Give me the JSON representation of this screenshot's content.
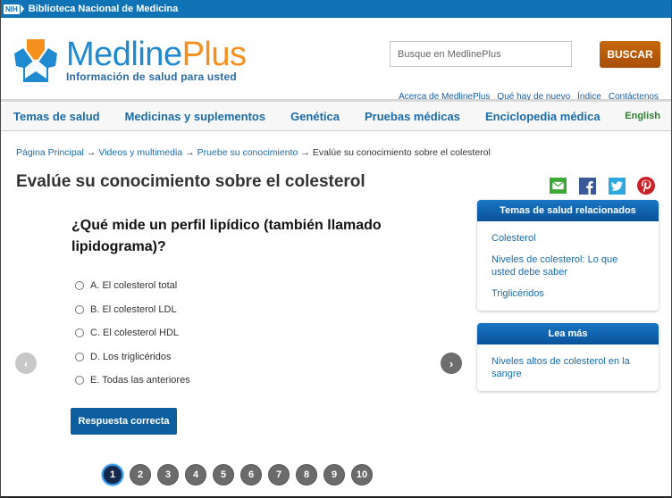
{
  "nih_bar": {
    "logo_text": "NIH",
    "title": "Biblioteca Nacional de Medicina"
  },
  "header": {
    "logo_name_main": "Medline",
    "logo_name_accent": "Plus",
    "logo_tagline": "Información de salud para usted",
    "search_placeholder": "Busque en MedlinePlus",
    "search_value": "",
    "search_button": "BUSCAR",
    "top_links": [
      "Acerca de MedlinePlus",
      "Qué hay de nuevo",
      "Índice",
      "Contáctenos"
    ]
  },
  "nav": {
    "items": [
      "Temas de salud",
      "Medicinas y suplementos",
      "Genética",
      "Pruebas médicas",
      "Enciclopedia médica"
    ],
    "language_link": "English"
  },
  "breadcrumb": {
    "links": [
      "Página Principal",
      "Videos y multimedia",
      "Pruebe su conocimiento"
    ],
    "current": "Evalúe su conocimiento sobre el colesterol",
    "separator": "→"
  },
  "page_title": "Evalúe su conocimiento sobre el colesterol",
  "share_icons": [
    "email-icon",
    "facebook-icon",
    "twitter-icon",
    "pinterest-icon"
  ],
  "quiz": {
    "question": "¿Qué mide un perfil lipídico (también llamado lipidograma)?",
    "options": [
      "A. El colesterol total",
      "B. El colesterol LDL",
      "C. El colesterol HDL",
      "D. Los triglicéridos",
      "E. Todas las anteriores"
    ],
    "answer_button": "Respuesta correcta",
    "prev_glyph": "‹",
    "next_glyph": "›",
    "pages": [
      "1",
      "2",
      "3",
      "4",
      "5",
      "6",
      "7",
      "8",
      "9",
      "10"
    ],
    "current_page": "1"
  },
  "sidebar": {
    "related": {
      "title": "Temas de salud relacionados",
      "links": [
        "Colesterol",
        "Niveles de colesterol: Lo que usted debe saber",
        "Triglicéridos"
      ]
    },
    "read_more": {
      "title": "Lea más",
      "links": [
        "Niveles altos de colesterol en la sangre"
      ]
    }
  },
  "colors": {
    "nih_bar": "#0F73B5",
    "brand_blue": "#1F8AD0",
    "brand_orange": "#F5901E",
    "search_button": "#B85C0A",
    "link": "#1A6BA8",
    "english_link": "#2E7D32",
    "answer_button": "#0D5E9E",
    "page_active": "#14284b"
  }
}
